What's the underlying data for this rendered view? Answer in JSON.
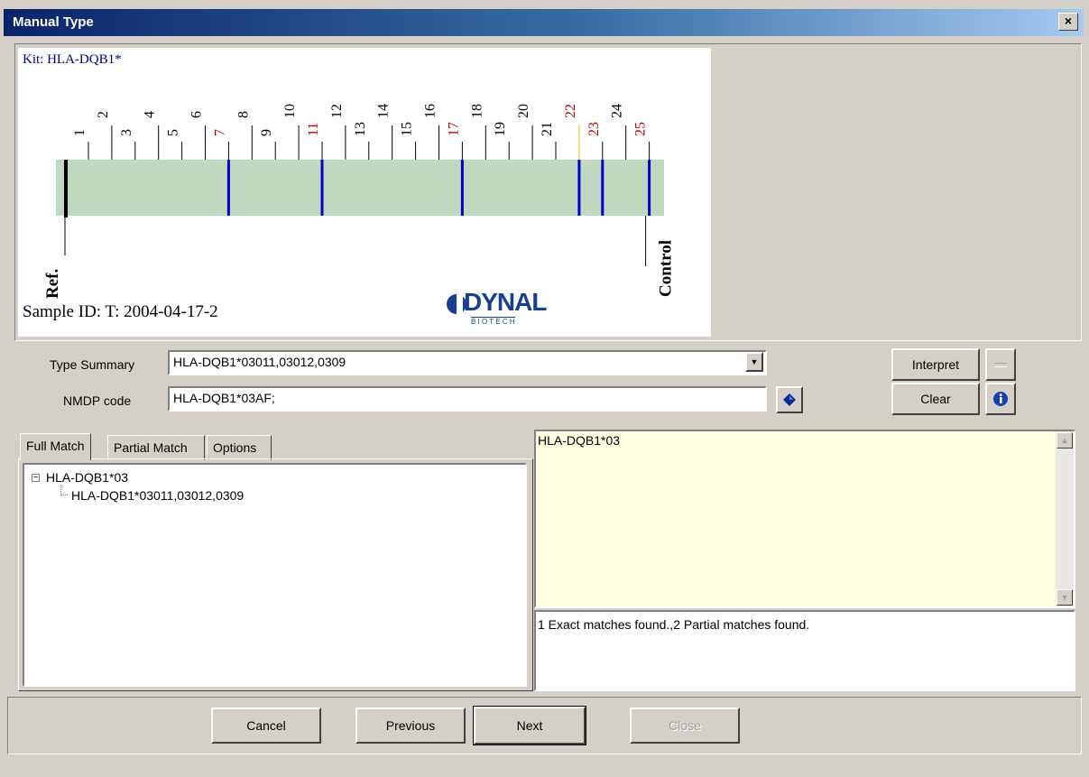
{
  "window": {
    "title": "Manual Type",
    "close_glyph": "×"
  },
  "strip": {
    "kit_label": "Kit: HLA-DQB1*",
    "sample_id": "Sample ID: T: 2004-04-17-2",
    "ref_label": "Ref.",
    "control_label": "Control",
    "logo_text": "DYNAL",
    "logo_subtext": "B I O T E C H",
    "lanes": [
      {
        "n": "1"
      },
      {
        "n": "2"
      },
      {
        "n": "3"
      },
      {
        "n": "4"
      },
      {
        "n": "5"
      },
      {
        "n": "6"
      },
      {
        "n": "7",
        "color": "#c00000"
      },
      {
        "n": "8"
      },
      {
        "n": "9"
      },
      {
        "n": "10"
      },
      {
        "n": "11",
        "color": "#c00000"
      },
      {
        "n": "12"
      },
      {
        "n": "13"
      },
      {
        "n": "14"
      },
      {
        "n": "15"
      },
      {
        "n": "16"
      },
      {
        "n": "17",
        "color": "#c00000"
      },
      {
        "n": "18"
      },
      {
        "n": "19"
      },
      {
        "n": "20"
      },
      {
        "n": "21"
      },
      {
        "n": "22",
        "color": "#c00000"
      },
      {
        "n": "23",
        "color": "#c00000"
      },
      {
        "n": "24"
      },
      {
        "n": "25",
        "color": "#c00000"
      }
    ],
    "positive_bands": [
      "7",
      "11",
      "17",
      "22",
      "23",
      "25"
    ],
    "band_color": "#0000cc",
    "strip_color": "#bfd9c0"
  },
  "form": {
    "type_summary_label": "Type Summary",
    "type_summary_value": "HLA-DQB1*03011,03012,0309",
    "nmdp_label": "NMDP code",
    "nmdp_value": "HLA-DQB1*03AF;",
    "interpret_label": "Interpret",
    "clear_label": "Clear"
  },
  "tabs": {
    "full_match": "Full Match",
    "partial_match": "Partial Match",
    "options": "Options"
  },
  "tree": {
    "root": "HLA-DQB1*03",
    "child": "HLA-DQB1*03011,03012,0309",
    "toggle_glyph": "−"
  },
  "detail": {
    "text": "HLA-DQB1*03",
    "status": "1 Exact matches found.,2 Partial matches found."
  },
  "footer": {
    "cancel": "Cancel",
    "previous": "Previous",
    "next": "Next",
    "close": "Close"
  }
}
